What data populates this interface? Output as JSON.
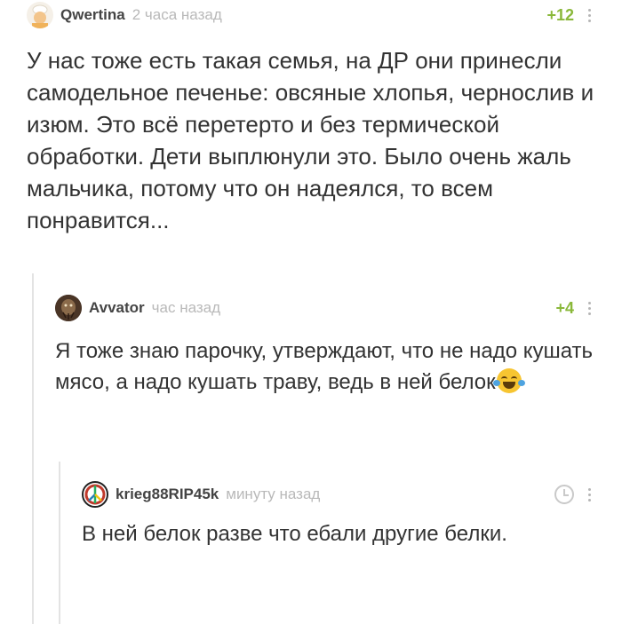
{
  "comments": [
    {
      "username": "Qwertina",
      "time": "2 часа назад",
      "rating": "+12",
      "text": "У нас тоже есть такая семья, на ДР они принесли самодельное печенье: овсяные хлопья, чернослив и изюм. Это всё перетерто и без термической обработки. Дети выплюнули это. Было очень жаль мальчика, потому что он надеялся, то всем понравится..."
    },
    {
      "username": "Avvator",
      "time": "час назад",
      "rating": "+4",
      "text": "Я тоже знаю парочку, утверждают, что не надо кушать мясо, а надо кушать траву, ведь в ней белок",
      "emoji": "laughing-tears-emoji"
    },
    {
      "username": "krieg88RIP45k",
      "time": "минуту назад",
      "rating_icon": "clock-icon",
      "text": "В ней белок разве что ебали другие белки."
    }
  ],
  "colors": {
    "rating_positive": "#8ab83a",
    "meta_text": "#b9b9b9",
    "thread_line": "#e3e3e3"
  }
}
